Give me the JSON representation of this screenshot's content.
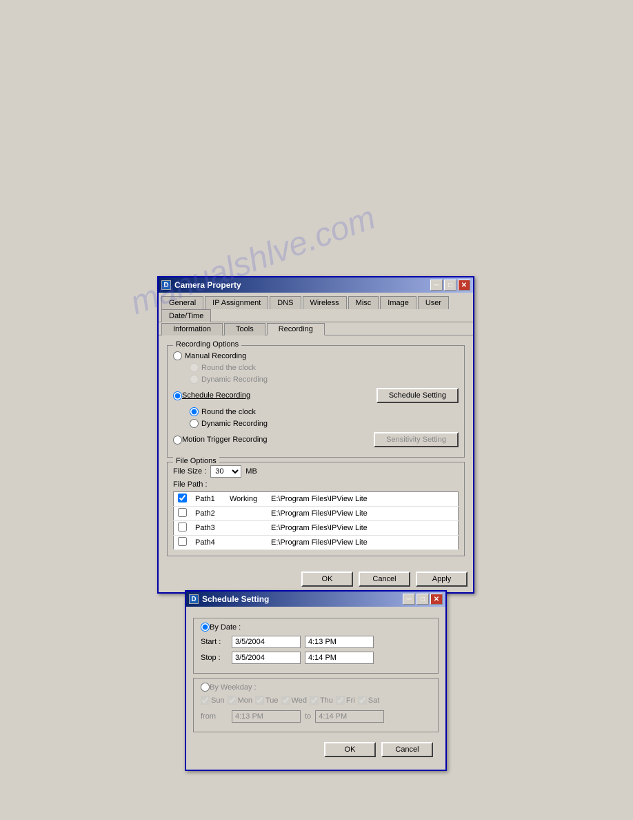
{
  "camera_property": {
    "title": "Camera Property",
    "icon_label": "D",
    "tabs_row1": [
      {
        "label": "General",
        "active": false
      },
      {
        "label": "IP Assignment",
        "active": false
      },
      {
        "label": "DNS",
        "active": false
      },
      {
        "label": "Wireless",
        "active": false
      },
      {
        "label": "Misc",
        "active": false
      },
      {
        "label": "Image",
        "active": false
      },
      {
        "label": "User",
        "active": false
      },
      {
        "label": "Date/Time",
        "active": false
      }
    ],
    "tabs_row2": [
      {
        "label": "Information",
        "active": false
      },
      {
        "label": "Tools",
        "active": false
      },
      {
        "label": "Recording",
        "active": true
      }
    ],
    "recording_options_label": "Recording Options",
    "manual_recording_label": "Manual Recording",
    "round_clock_disabled_label": "Round the clock",
    "dynamic_recording_disabled_label": "Dynamic Recording",
    "schedule_recording_label": "Schedule Recording",
    "schedule_setting_btn": "Schedule Setting",
    "round_clock_label": "Round the clock",
    "dynamic_recording_label": "Dynamic Recording",
    "motion_trigger_label": "Motion Trigger Recording",
    "sensitivity_setting_btn": "Sensitivity Setting",
    "file_options_label": "File Options",
    "file_size_label": "File Size :",
    "file_path_label": "File Path :",
    "file_size_value": "30",
    "file_size_unit": "MB",
    "paths": [
      {
        "checked": true,
        "name": "Path1",
        "status": "Working",
        "path": "E:\\Program Files\\IPView Lite"
      },
      {
        "checked": false,
        "name": "Path2",
        "status": "",
        "path": "E:\\Program Files\\IPView Lite"
      },
      {
        "checked": false,
        "name": "Path3",
        "status": "",
        "path": "E:\\Program Files\\IPView Lite"
      },
      {
        "checked": false,
        "name": "Path4",
        "status": "",
        "path": "E:\\Program Files\\IPView Lite"
      }
    ],
    "ok_btn": "OK",
    "cancel_btn": "Cancel",
    "apply_btn": "Apply"
  },
  "schedule_setting": {
    "title": "Schedule Setting",
    "icon_label": "D",
    "by_date_label": "By Date :",
    "start_label": "Start :",
    "stop_label": "Stop :",
    "start_date": "3/5/2004",
    "start_time": "4:13 PM",
    "stop_date": "3/5/2004",
    "stop_time": "4:14 PM",
    "by_weekday_label": "By Weekday :",
    "weekdays": [
      {
        "label": "Sun",
        "checked": true
      },
      {
        "label": "Mon",
        "checked": true
      },
      {
        "label": "Tue",
        "checked": true
      },
      {
        "label": "Wed",
        "checked": true
      },
      {
        "label": "Thu",
        "checked": true
      },
      {
        "label": "Fri",
        "checked": true
      },
      {
        "label": "Sat",
        "checked": true
      }
    ],
    "from_label": "from",
    "to_label": "to",
    "from_time": "4:13 PM",
    "to_time": "4:14 PM",
    "ok_btn": "OK",
    "cancel_btn": "Cancel"
  }
}
